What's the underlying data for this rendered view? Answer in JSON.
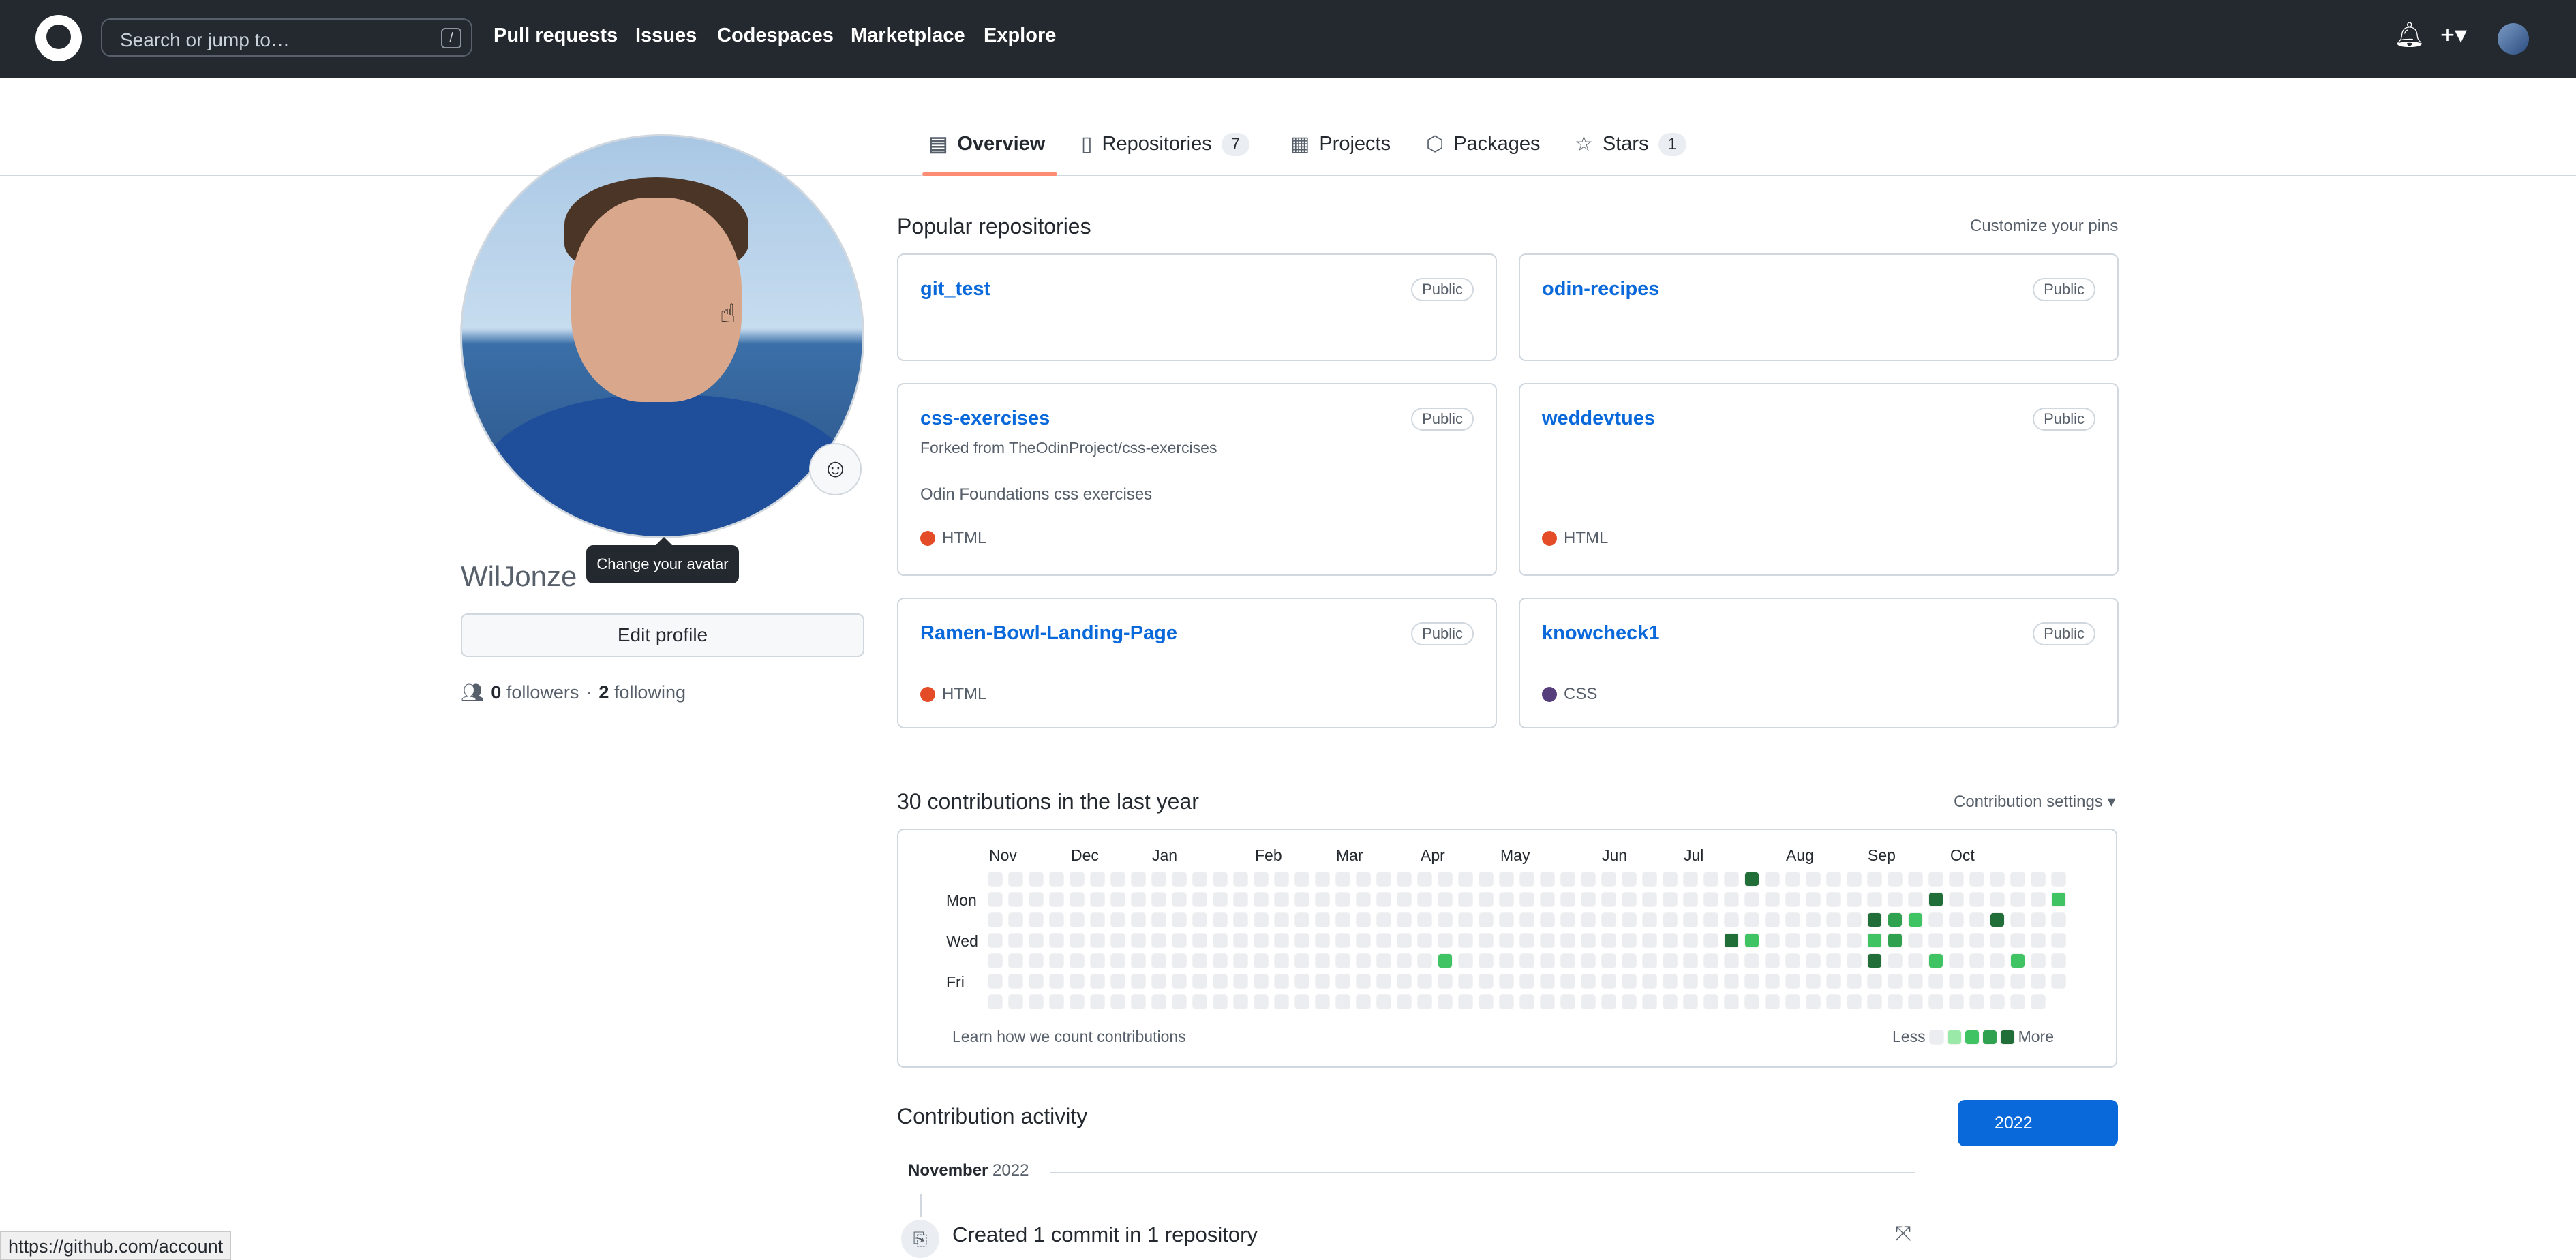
{
  "header": {
    "search_placeholder": "Search or jump to…",
    "search_shortcut": "/",
    "nav": [
      "Pull requests",
      "Issues",
      "Codespaces",
      "Marketplace",
      "Explore"
    ],
    "plus_label": "+▾"
  },
  "tabs": [
    {
      "label": "Overview",
      "icon": "book-icon"
    },
    {
      "label": "Repositories",
      "count": "7",
      "icon": "repo-icon"
    },
    {
      "label": "Projects",
      "icon": "table-icon"
    },
    {
      "label": "Packages",
      "icon": "package-icon"
    },
    {
      "label": "Stars",
      "count": "1",
      "icon": "star-icon"
    }
  ],
  "profile": {
    "tooltip": "Change your avatar",
    "username": "WilJonze",
    "edit_label": "Edit profile",
    "followers_count": "0",
    "followers_label": "followers",
    "separator": "·",
    "following_count": "2",
    "following_label": "following"
  },
  "popular": {
    "title": "Popular repositories",
    "customize": "Customize your pins",
    "repos": [
      {
        "name": "git_test",
        "badge": "Public"
      },
      {
        "name": "odin-recipes",
        "badge": "Public"
      },
      {
        "name": "css-exercises",
        "badge": "Public",
        "fork": "Forked from TheOdinProject/css-exercises",
        "desc": "Odin Foundations css exercises",
        "lang": "HTML",
        "lang_color": "#e34c26"
      },
      {
        "name": "weddevtues",
        "badge": "Public",
        "lang": "HTML",
        "lang_color": "#e34c26"
      },
      {
        "name": "Ramen-Bowl-Landing-Page",
        "badge": "Public",
        "lang": "HTML",
        "lang_color": "#e34c26"
      },
      {
        "name": "knowcheck1",
        "badge": "Public",
        "lang": "CSS",
        "lang_color": "#563d7c"
      }
    ]
  },
  "contributions": {
    "title": "30 contributions in the last year",
    "settings": "Contribution settings ▾",
    "months": [
      "Nov",
      "Dec",
      "Jan",
      "Feb",
      "Mar",
      "Apr",
      "May",
      "Jun",
      "Jul",
      "Aug",
      "Sep",
      "Oct"
    ],
    "days": [
      "Mon",
      "Wed",
      "Fri"
    ],
    "learn": "Learn how we count contributions",
    "less": "Less",
    "more": "More",
    "level_colors": [
      "#ebedf0",
      "#9be9a8",
      "#40c463",
      "#30a14e",
      "#216e39"
    ],
    "active_cells": [
      [
        37,
        0,
        4
      ],
      [
        46,
        1,
        4
      ],
      [
        52,
        1,
        2
      ],
      [
        43,
        2,
        4
      ],
      [
        44,
        2,
        3
      ],
      [
        45,
        2,
        2
      ],
      [
        49,
        2,
        4
      ],
      [
        36,
        3,
        4
      ],
      [
        37,
        3,
        2
      ],
      [
        43,
        3,
        2
      ],
      [
        44,
        3,
        3
      ],
      [
        22,
        4,
        2
      ],
      [
        43,
        4,
        4
      ],
      [
        46,
        4,
        2
      ],
      [
        50,
        4,
        2
      ]
    ]
  },
  "activity": {
    "title": "Contribution activity",
    "year": "2022",
    "month": "November",
    "month_year": "2022",
    "item": "Created 1 commit in 1 repository"
  },
  "statusbar": "https://github.com/account"
}
